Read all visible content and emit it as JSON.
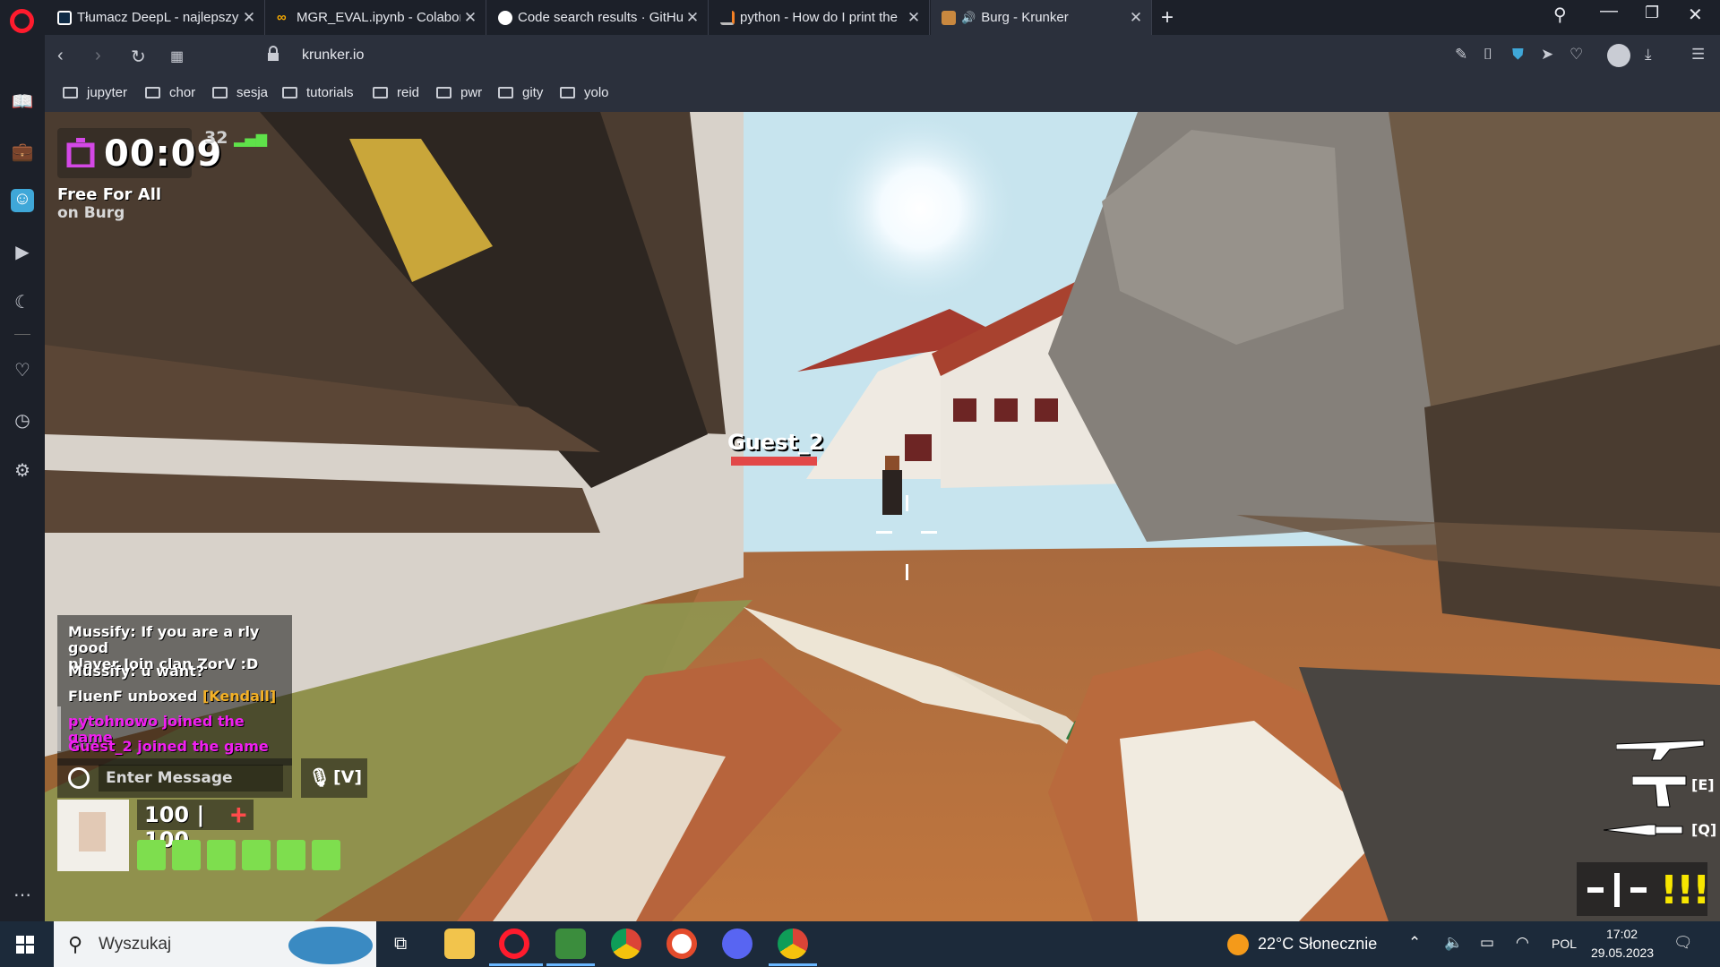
{
  "browser": {
    "tabs": [
      {
        "title": "Tłumacz DeepL - najlepszy",
        "favicon": "deepl-icon",
        "active": false
      },
      {
        "title": "MGR_EVAL.ipynb - Colabor",
        "favicon": "colab-icon",
        "active": false
      },
      {
        "title": "Code search results · GitHu",
        "favicon": "github-icon",
        "active": false
      },
      {
        "title": "python - How do I print the",
        "favicon": "stackoverflow-icon",
        "active": false
      },
      {
        "title": "Burg - Krunker",
        "favicon": "krunker-icon",
        "active": true
      }
    ],
    "url": "krunker.io",
    "bookmarks": [
      "jupyter",
      "chor",
      "sesja",
      "tutorials",
      "reid",
      "pwr",
      "gity",
      "yolo"
    ]
  },
  "game": {
    "timer": "00:09",
    "ping": "32",
    "mode": "Free For All",
    "map": "on Burg",
    "chat": [
      {
        "user": "Mussify:",
        "text": " If you are a rly good",
        "text2": "player Join clan ZorV :D"
      },
      {
        "user": "Mussify:",
        "text": " u want?"
      },
      {
        "user": "FluenF",
        "text": " unboxed ",
        "item": "[Kendall]"
      },
      {
        "system": "pytohnowo joined the game"
      },
      {
        "system": "Guest_2 joined the game"
      }
    ],
    "chat_placeholder": "Enter Message",
    "voice_key": "[V]",
    "health": "100 | 100",
    "ammo_pips": 6,
    "enemy_name": "Guest_2",
    "weapon_keys": {
      "secondary": "[E]",
      "melee": "[Q]"
    },
    "ammo_indicator": "!!!"
  },
  "taskbar": {
    "search_placeholder": "Wyszukaj",
    "weather": "22°C  Słonecznie",
    "language": "POL",
    "time": "17:02",
    "date": "29.05.2023"
  },
  "colors": {
    "accent": "#3fa7d8",
    "opera": "#ff1b2d",
    "system_chat": "#f01ff0",
    "unbox_item": "#f4b126",
    "health_pip": "#7ede4e",
    "enemy_hp": "#e24848"
  }
}
